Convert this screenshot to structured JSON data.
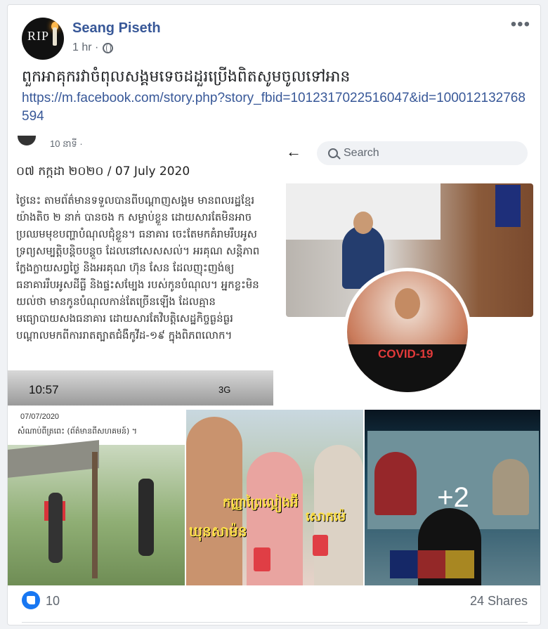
{
  "post": {
    "author": "Seang Piseth",
    "time": "1 hr ·",
    "avatar_text": "RIP",
    "text": "ពួកអាគុករវាចំពុលសង្គមទេចដដួរប្រើងពិតសូមចូលទៅអាន",
    "link": "https://m.facebook.com/story.php?story_fbid=1012317022516047&id=100012132768594"
  },
  "images": {
    "doc": {
      "ago": "10 នាទី ·",
      "date": "០៧ កក្កដា ២០២០ / 07 July 2020",
      "body": "ថ្ងៃនេះ តាមព័ត៌មានទទួលបានពីបណ្តាញសង្គម មានពលរដ្ឋខ្មែរយ៉ាងតិច ២ នាក់ បានចង ក សម្លាប់ខ្លួន ដោយសារតែមិនអាចប្រឈមមុខបញ្ហាបំណុលជុំខ្លួន។ ធនាគារ ចេះតែមកគំរាមរឹបអូសទ្រព្យសម្បត្តិបន្តិចបន្តួច ដែលនៅសេសសល់។ អរគុណ សន្តិភាពក្លែងក្លាយសព្វថ្ងៃ និងអរគុណ ហ៊ុន សែន ដែលញុះញង់ឲ្យធនាគាររឹបអូសដីធ្លី និងផ្ទះសម្បែង របស់កូនបំណុល។ អ្នកខ្លះមិនយល់ថា មានកូនបំណុលកាន់តែច្រើនឡើង ដែលគ្មានមធ្យោបាយសងធនាគារ ដោយសារតែវិបត្តិសេដ្ឋកិច្ចធ្ងន់ធ្ងរ បណ្តាលមកពីការរាតត្បាតជំងឺកូវីដ-១៩ ក្នុងពិភពលោក។",
      "clock": "10:57",
      "signal": "3G"
    },
    "profile": {
      "search_placeholder": "Search",
      "badge_text": "COVID-19"
    },
    "photo3": {
      "stamp": "07/07/2020",
      "caption": "សំណាប់ពីត្រពេះ (ព័ត៌មានពីសហគមន៍) ។"
    },
    "photo4": {
      "text1": "កញ្ញាព្រៃល្អៀងអ៊ី",
      "text2": "ឃុនសាម៉ន",
      "text3": "សោកម៉េ"
    },
    "more_count": "+2"
  },
  "footer": {
    "likes": "10",
    "shares": "24 Shares"
  },
  "colors": {
    "brand_link": "#385898",
    "like_blue": "#1877f2"
  }
}
